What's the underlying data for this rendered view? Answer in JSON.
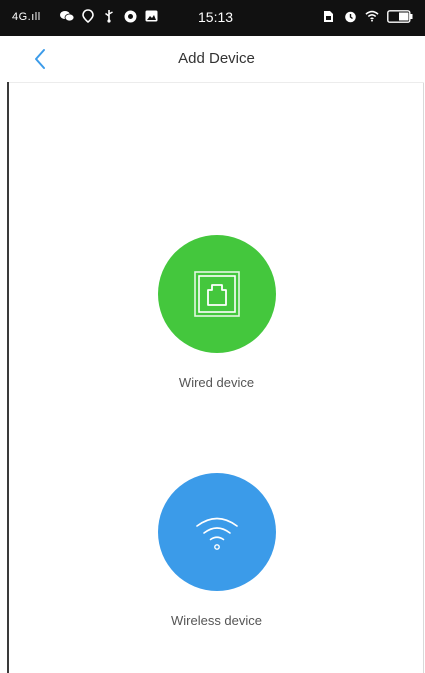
{
  "status_bar": {
    "signal": "4G.ıll",
    "time": "15:13",
    "icons": [
      "wechat-icon",
      "location-icon",
      "usb-icon",
      "vpn-icon",
      "gallery-icon",
      "sim-icon",
      "alarm-icon",
      "wifi-icon",
      "battery-icon"
    ]
  },
  "nav": {
    "title": "Add Device",
    "back_icon": "chevron-left-icon"
  },
  "options": {
    "wired": {
      "label": "Wired device",
      "icon": "ethernet-port-icon",
      "color": "#44c73d"
    },
    "wireless": {
      "label": "Wireless device",
      "icon": "wifi-icon",
      "color": "#3b9be9"
    }
  },
  "colors": {
    "accent": "#3b9be9",
    "status_bar_bg": "#111111"
  }
}
